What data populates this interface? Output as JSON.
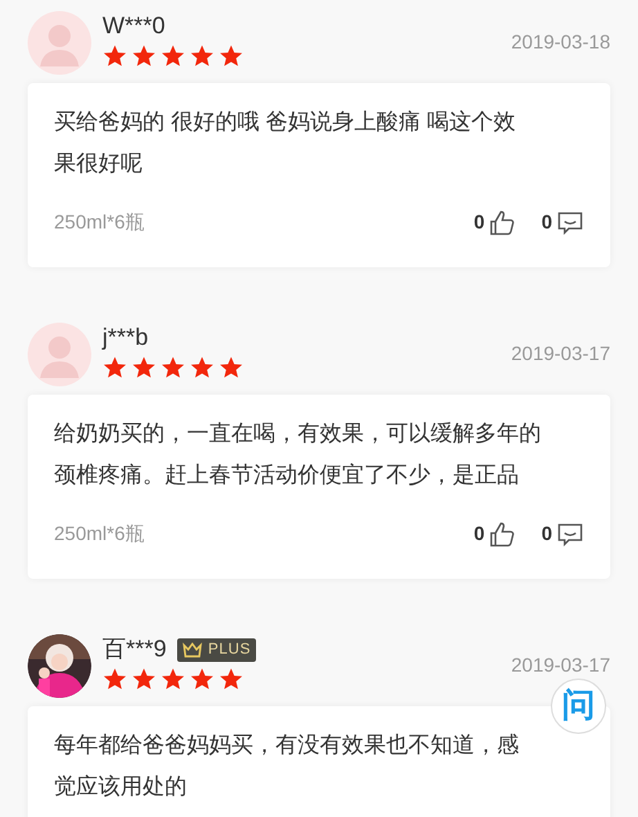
{
  "reviews": [
    {
      "user": "W***0",
      "stars": 5,
      "date": "2019-03-18",
      "text_lines": [
        "买给爸妈的 很好的哦 爸妈说身上酸痛 喝这个效",
        "果很好呢"
      ],
      "spec": "250ml*6瓶",
      "likes": "0",
      "comments": "0"
    },
    {
      "user": "j***b",
      "stars": 5,
      "date": "2019-03-17",
      "text_lines": [
        "给奶奶买的，一直在喝，有效果，可以缓解多年的",
        "颈椎疼痛。赶上春节活动价便宜了不少，是正品"
      ],
      "spec": "250ml*6瓶",
      "likes": "0",
      "comments": "0"
    },
    {
      "user": "百***9",
      "avatar": {
        "kind": "picture"
      },
      "plus_label": "PLUS",
      "stars": 5,
      "date": "2019-03-17",
      "text_lines": [
        "每年都给爸爸妈妈买，有没有效果也不知道，感",
        "觉应该用处的"
      ]
    }
  ],
  "ask_button": {
    "label": "问"
  }
}
